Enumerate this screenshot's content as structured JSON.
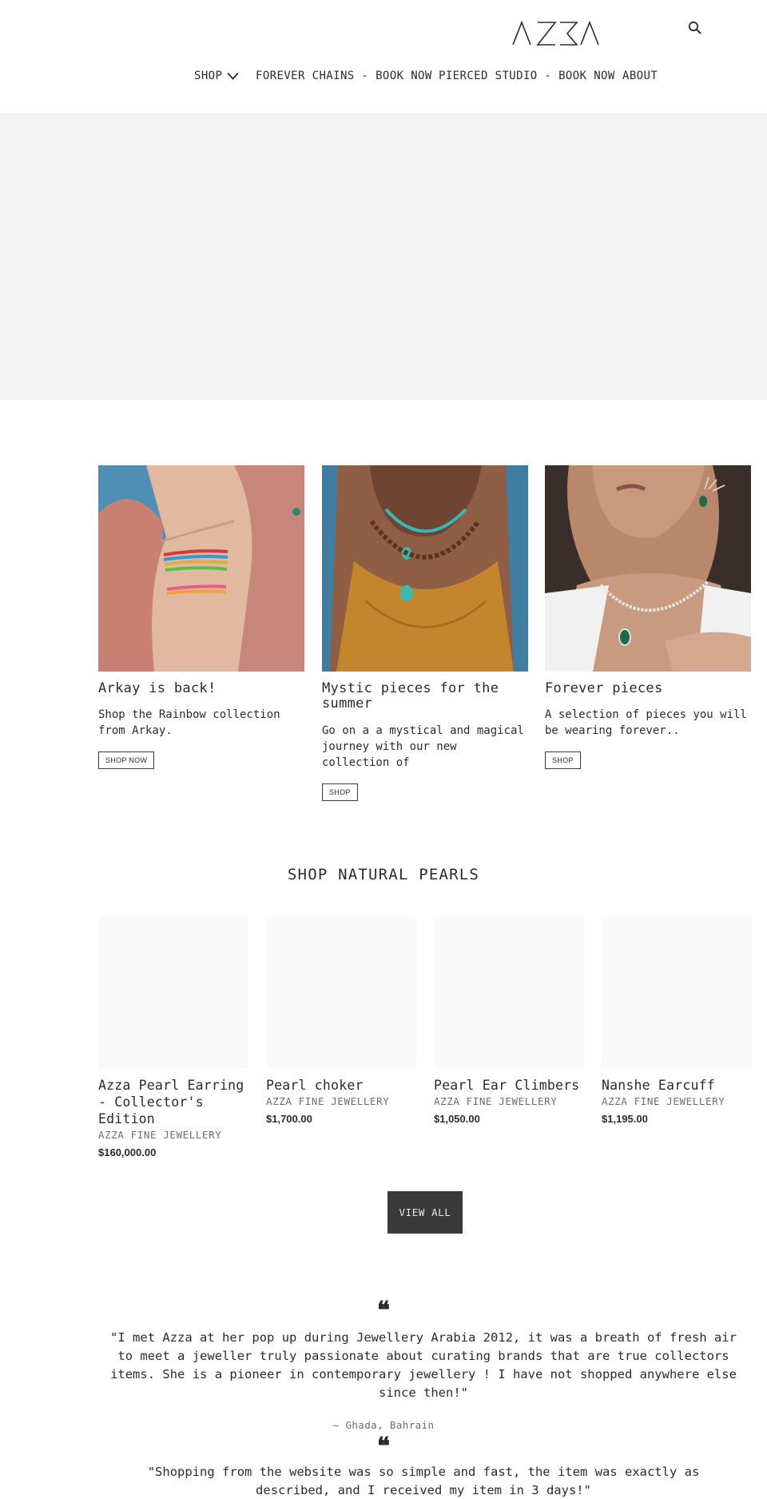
{
  "header": {
    "logo_text": "AZZA",
    "search_icon": "search-icon"
  },
  "nav": {
    "shop": "SHOP",
    "forever_chains": "FOREVER CHAINS - BOOK NOW",
    "pierced_studio": "PIERCED STUDIO - BOOK NOW",
    "about": "ABOUT"
  },
  "collections": [
    {
      "title": "Arkay is back!",
      "text": "Shop the Rainbow collection from Arkay.",
      "button": "SHOP NOW"
    },
    {
      "title": "Mystic pieces for the summer",
      "text": "Go on a a mystical and magical journey with our new collection of",
      "button": "SHOP"
    },
    {
      "title": "Forever pieces",
      "text": "A selection of pieces you will be wearing forever..",
      "button": "SHOP"
    }
  ],
  "pearls": {
    "heading": "SHOP NATURAL PEARLS",
    "products": [
      {
        "title": "Azza Pearl Earring - Collector's Edition",
        "vendor": "AZZA FINE JEWELLERY",
        "price": "$160,000.00"
      },
      {
        "title": "Pearl choker",
        "vendor": "AZZA FINE JEWELLERY",
        "price": "$1,700.00"
      },
      {
        "title": "Pearl Ear Climbers",
        "vendor": "AZZA FINE JEWELLERY",
        "price": "$1,050.00"
      },
      {
        "title": "Nanshe Earcuff",
        "vendor": "AZZA FINE JEWELLERY",
        "price": "$1,195.00"
      }
    ],
    "view_all": "VIEW ALL"
  },
  "testimonials": [
    {
      "quote_mark": "❝",
      "text": "\"I met Azza at her pop up during Jewellery Arabia 2012, it was a breath of fresh air to meet a jeweller truly passionate about curating brands that are true collectors items. She is a pioneer in contemporary jewellery ! I have not shopped anywhere else since then!\"",
      "author": "— Ghada, Bahrain"
    },
    {
      "quote_mark": "❝",
      "text": "\"Shopping from the website was so simple and fast, the item was exactly as described, and I received my item in 3 days!\""
    }
  ],
  "colors": {
    "text": "#2b2b2b",
    "muted": "#6d6d6d",
    "hero_bg": "#f5f5f5",
    "button_dark": "#3a3a3a"
  }
}
